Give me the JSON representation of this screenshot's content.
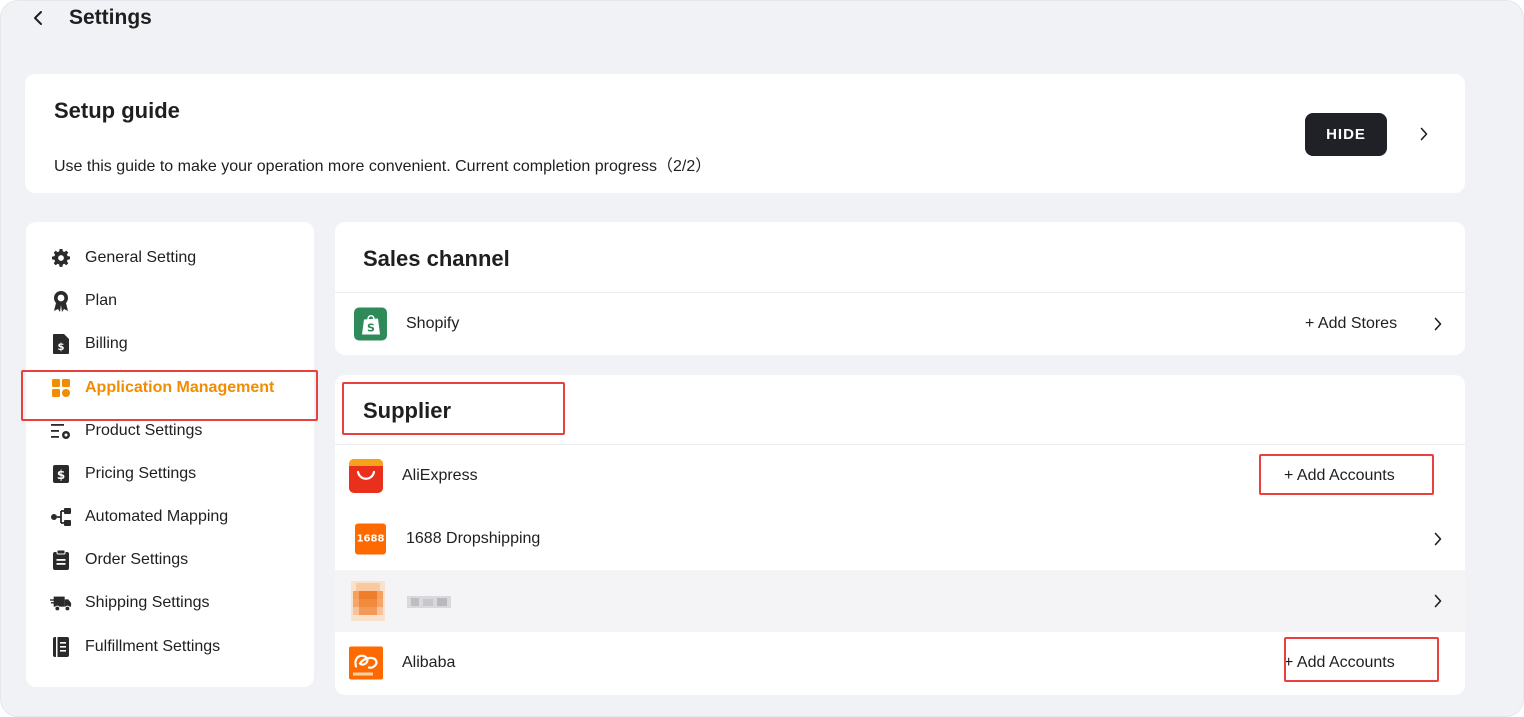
{
  "header": {
    "title": "Settings"
  },
  "setup_guide": {
    "title": "Setup guide",
    "description": "Use this guide to make your operation more convenient. Current completion progress（2/2）",
    "hide_label": "HIDE"
  },
  "sidebar": {
    "items": [
      {
        "label": "General Setting",
        "icon": "gear-icon"
      },
      {
        "label": "Plan",
        "icon": "award-icon"
      },
      {
        "label": "Billing",
        "icon": "bill-icon"
      },
      {
        "label": "Application Management",
        "icon": "apps-grid-icon",
        "active": true
      },
      {
        "label": "Product Settings",
        "icon": "list-settings-icon"
      },
      {
        "label": "Pricing Settings",
        "icon": "dollar-card-icon"
      },
      {
        "label": "Automated Mapping",
        "icon": "mapping-icon"
      },
      {
        "label": "Order Settings",
        "icon": "clipboard-icon"
      },
      {
        "label": "Shipping Settings",
        "icon": "truck-icon"
      },
      {
        "label": "Fulfillment Settings",
        "icon": "book-icon"
      }
    ]
  },
  "sales_channel": {
    "title": "Sales channel",
    "rows": [
      {
        "label": "Shopify",
        "action": "+ Add Stores"
      }
    ]
  },
  "supplier": {
    "title": "Supplier",
    "rows": [
      {
        "label": "AliExpress",
        "action": "+ Add Accounts"
      },
      {
        "label": "1688 Dropshipping",
        "logo_text": "1688"
      },
      {
        "label": ""
      },
      {
        "label": "Alibaba",
        "action": "+ Add Accounts"
      }
    ]
  },
  "colors": {
    "accent": "#f28c00",
    "highlight_box": "#e8403c",
    "dark_button": "#1f2126",
    "shopify": "#2f8a5a",
    "aliexpress": "#e8301c",
    "orange_1688": "#ff6a00"
  }
}
